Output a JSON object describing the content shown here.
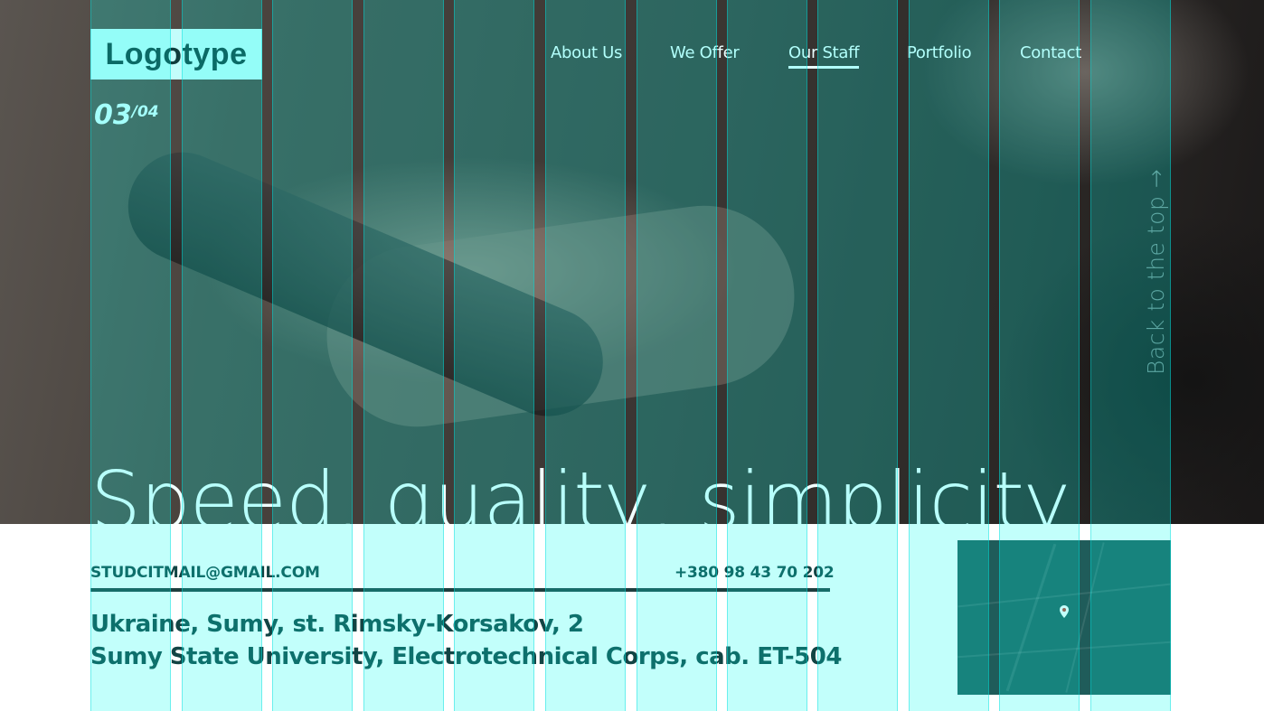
{
  "header": {
    "logo": "Logotype",
    "nav": [
      {
        "label": "About Us",
        "active": false
      },
      {
        "label": "We Offer",
        "active": false
      },
      {
        "label": "Our Staff",
        "active": true
      },
      {
        "label": "Portfolio",
        "active": false
      },
      {
        "label": "Contact",
        "active": false
      }
    ]
  },
  "slider": {
    "current": "03",
    "total": "/04"
  },
  "hero": {
    "headline": "Speed, quality, simplicity",
    "back_to_top": "Back to the top →"
  },
  "contacts": {
    "email": "STUDCITMAIL@GMAIL.COM",
    "phone": "+380 98 43 70 202",
    "address_line1": "Ukraine, Sumy, st. Rimsky-Korsakov, 2",
    "address_line2": "Sumy State University, Electrotechnical Corps, cab. ET-504"
  },
  "colors": {
    "grid_overlay": "#00fff0",
    "text_dark": "#124444",
    "logo_bg": "#c3fdfb",
    "map_bg": "#1f5c5a"
  },
  "icons": {
    "map_marker": "map-pin-icon"
  }
}
